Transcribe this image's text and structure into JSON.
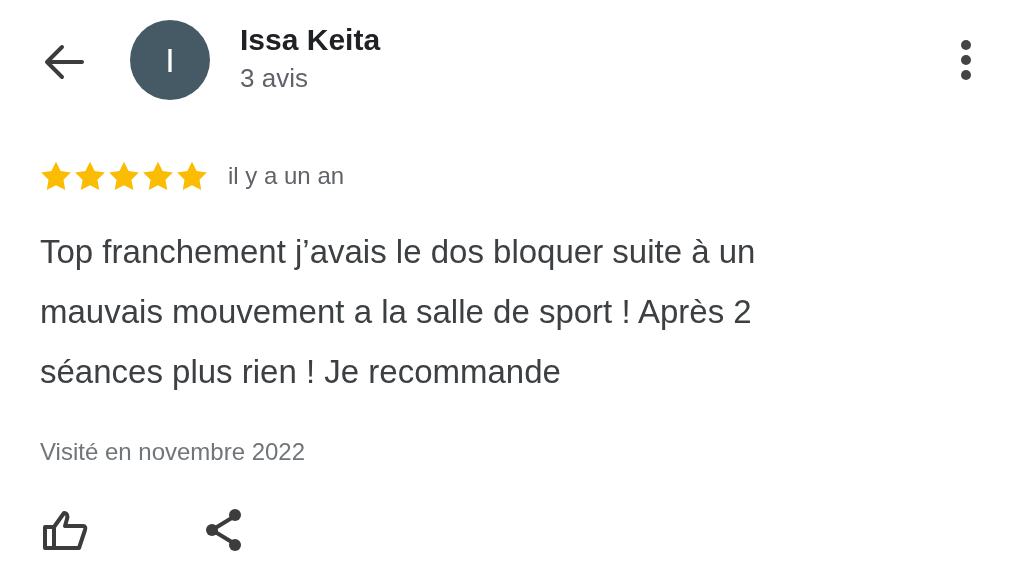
{
  "reviewer": {
    "initial": "I",
    "name": "Issa Keita",
    "review_count": "3 avis"
  },
  "review": {
    "stars": 5,
    "time": "il y a un an",
    "text": "Top franchement j’avais le dos bloquer suite à un mauvais mouvement a la salle de sport ! Après 2 séances plus rien ! Je recommande",
    "visited": "Visité en novembre 2022"
  }
}
